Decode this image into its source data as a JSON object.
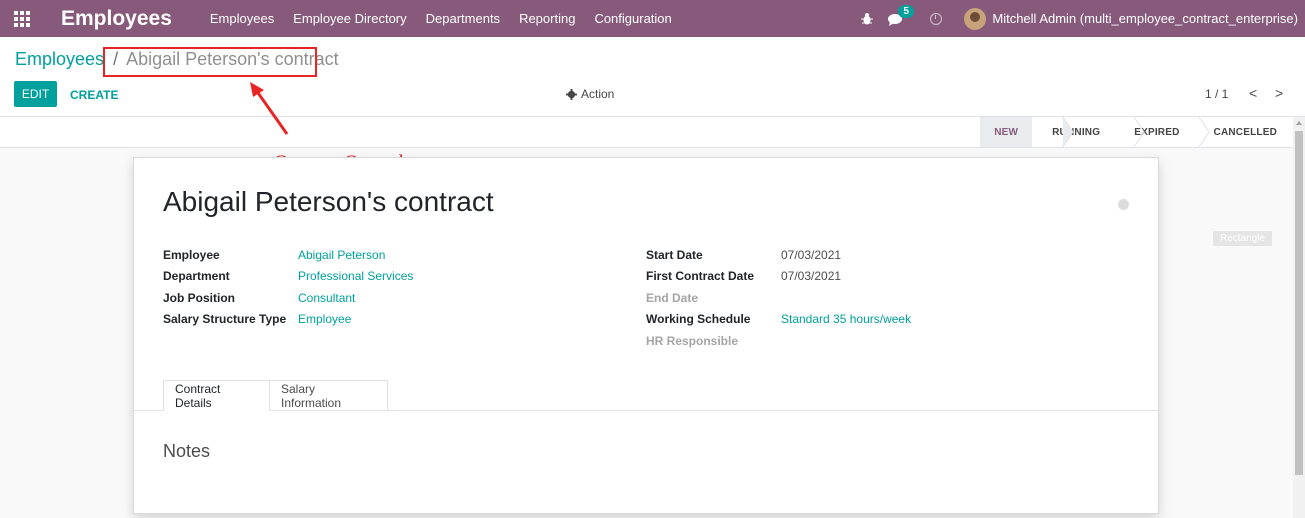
{
  "navbar": {
    "brand": "Employees",
    "menu": [
      "Employees",
      "Employee Directory",
      "Departments",
      "Reporting",
      "Configuration"
    ],
    "chat_count": "5",
    "user": "Mitchell Admin (multi_employee_contract_enterprise)"
  },
  "breadcrumb": {
    "parent": "Employees",
    "separator": "/",
    "current": "Abigail Peterson's contract"
  },
  "buttons": {
    "edit": "EDIT",
    "create": "CREATE",
    "action": "Action"
  },
  "pager": {
    "value": "1 / 1",
    "prev": "<",
    "next": ">"
  },
  "statusbar": [
    "NEW",
    "RUNNING",
    "EXPIRED",
    "CANCELLED"
  ],
  "statusbar_active": "NEW",
  "annotation": {
    "text": "Contract Created."
  },
  "form": {
    "title": "Abigail Peterson's contract",
    "left": {
      "employee_label": "Employee",
      "employee_value": "Abigail Peterson",
      "department_label": "Department",
      "department_value": "Professional Services",
      "job_label": "Job Position",
      "job_value": "Consultant",
      "salary_type_label": "Salary Structure Type",
      "salary_type_value": "Employee"
    },
    "right": {
      "start_label": "Start Date",
      "start_value": "07/03/2021",
      "first_contract_label": "First Contract Date",
      "first_contract_value": "07/03/2021",
      "end_label": "End Date",
      "schedule_label": "Working Schedule",
      "schedule_value": "Standard 35 hours/week",
      "hr_label": "HR Responsible"
    },
    "tabs": [
      "Contract Details",
      "Salary Information"
    ],
    "notes_title": "Notes"
  },
  "side_badge": "Rectangle",
  "colors": {
    "navbar": "#875a7b",
    "accent": "#00a09d",
    "annotation": "#e82525"
  }
}
